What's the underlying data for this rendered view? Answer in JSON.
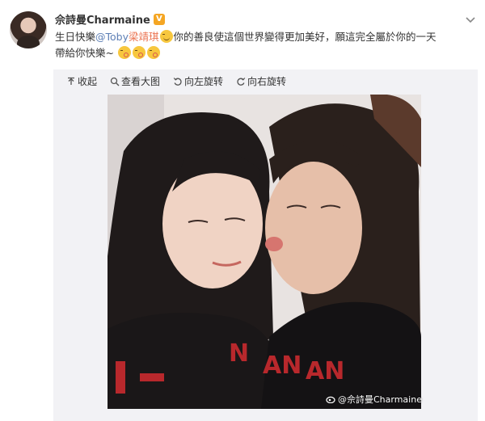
{
  "post": {
    "username": "佘詩曼Charmaine",
    "verified_label": "V",
    "text_line1_a": "生日快樂",
    "mention_toby": "@Toby",
    "mention_name": "梁靖琪",
    "text_line1_b": "你的善良使這個世界變得更加美好，願這完全屬於你的一天",
    "text_line2": "帶給你快樂~"
  },
  "toolbar": {
    "collapse_label": "收起",
    "view_large_label": "查看大图",
    "rotate_left_label": "向左旋转",
    "rotate_right_label": "向右旋转"
  },
  "photo": {
    "watermark": "@佘詩曼Charmaine"
  },
  "icons": {
    "collapse": "collapse-up-icon",
    "view_large": "magnifier-icon",
    "rotate_left": "rotate-left-icon",
    "rotate_right": "rotate-right-icon",
    "menu": "chevron-down-icon",
    "verified": "verified-badge-icon"
  },
  "colors": {
    "mention_orange": "#eb7350",
    "mention_blue": "#5d7fb5",
    "badge": "#f5a623",
    "panel_bg": "#f2f2f5"
  }
}
